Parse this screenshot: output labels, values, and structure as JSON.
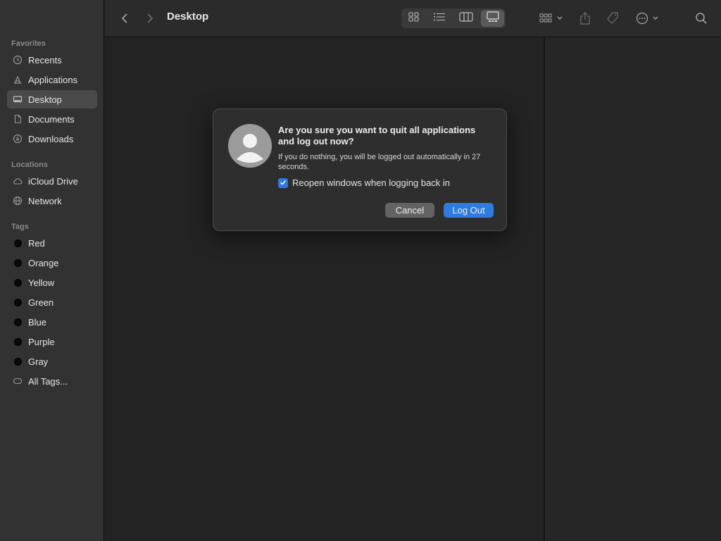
{
  "window": {
    "title": "Desktop"
  },
  "sidebar": {
    "sections": [
      {
        "title": "Favorites"
      },
      {
        "title": "Locations"
      },
      {
        "title": "Tags"
      }
    ],
    "favorites": [
      {
        "label": "Recents",
        "icon": "clock-icon"
      },
      {
        "label": "Applications",
        "icon": "applications-icon"
      },
      {
        "label": "Desktop",
        "icon": "desktop-icon",
        "selected": true
      },
      {
        "label": "Documents",
        "icon": "document-icon"
      },
      {
        "label": "Downloads",
        "icon": "download-icon"
      }
    ],
    "locations": [
      {
        "label": "iCloud Drive",
        "icon": "cloud-icon"
      },
      {
        "label": "Network",
        "icon": "globe-icon"
      }
    ],
    "tags": [
      {
        "label": "Red"
      },
      {
        "label": "Orange"
      },
      {
        "label": "Yellow"
      },
      {
        "label": "Green"
      },
      {
        "label": "Blue"
      },
      {
        "label": "Purple"
      },
      {
        "label": "Gray"
      },
      {
        "label": "All Tags..."
      }
    ]
  },
  "dialog": {
    "title": "Are you sure you want to quit all applications and log out now?",
    "message": "If you do nothing, you will be logged out automatically in 27 seconds.",
    "checkbox_label": "Reopen windows when logging back in",
    "checkbox_checked": true,
    "cancel_label": "Cancel",
    "confirm_label": "Log Out"
  },
  "colors": {
    "accent": "#2f7bdf",
    "sidebar_bg": "#323232",
    "content_bg": "#232323"
  }
}
